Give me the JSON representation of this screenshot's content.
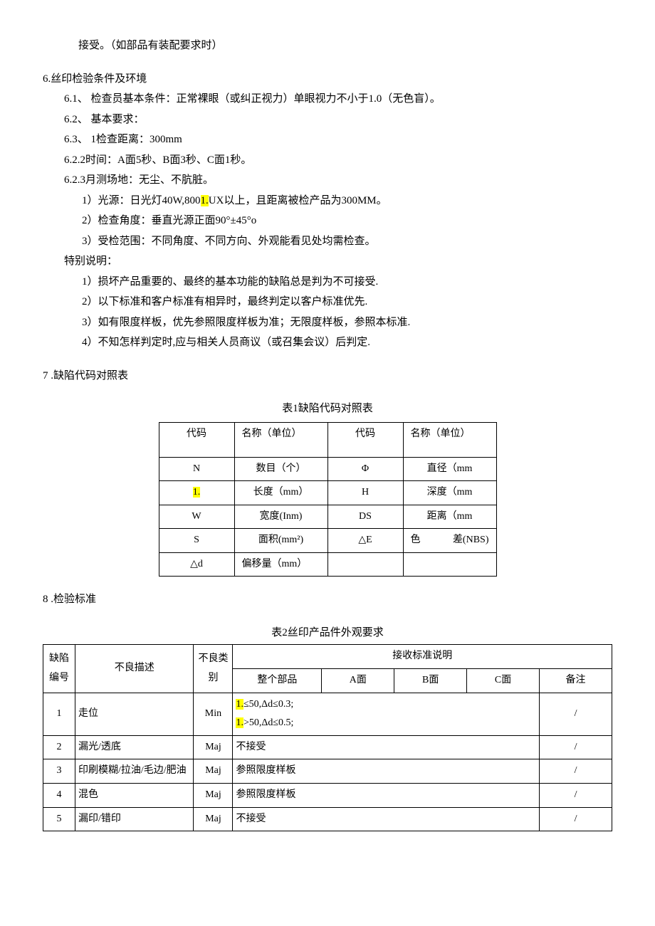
{
  "top_line": "接受。（如部品有装配要求时）",
  "s6": {
    "heading": "6.丝印检验条件及环境",
    "p1": "6.1、  检查员基本条件：正常裸眼（或纠正视力）单眼视力不小于1.0（无色盲）。",
    "p2": "6.2、  基本要求：",
    "p3": "6.3、 1检查距离：300mm",
    "p4": "6.2.2时间：A面5秒、B面3秒、C面1秒。",
    "p5": "6.2.3月测场地：无尘、不肮脏。",
    "p6_a": "1）光源：日光灯40W,800",
    "p6_hl": "1.",
    "p6_b": "UX以上，且距离被检产品为300MM。",
    "p7": "2）检查角度：垂直光源正面90°±45°o",
    "p8": "3）受检范围：不同角度、不同方向、外观能看见处均需检查。",
    "sp": "特别说明：",
    "sp1": "1）损坏产品重要的、最终的基本功能的缺陷总是判为不可接受.",
    "sp2": "2）以下标准和客户标准有相异时，最终判定以客户标准优先.",
    "sp3": "3）如有限度样板，优先参照限度样板为准；无限度样板，参照本标准.",
    "sp4": "4）不知怎样判定时,应与相关人员商议（或召集会议）后判定."
  },
  "s7": {
    "heading": "7   .缺陷代码对照表",
    "caption": "表1缺陷代码对照表",
    "head": [
      "代码",
      "名称（单位）",
      "代码",
      "名称（单位）"
    ],
    "rows": [
      {
        "a": "N",
        "b": "数目（个）",
        "c": "Φ",
        "d": "直径（mm"
      },
      {
        "a_hl": "1.",
        "b": "长度（mm）",
        "c": "H",
        "d": "深度（mm"
      },
      {
        "a": "W",
        "b": "宽度(Inm)",
        "c": "DS",
        "d": "距离（mm"
      },
      {
        "a": "S",
        "b": "面积(mm²)",
        "c": "△E",
        "d_a": "色",
        "d_b": "差(NBS)"
      },
      {
        "a": "△d",
        "b": "偏移量（mm）",
        "c": "",
        "d": ""
      }
    ]
  },
  "s8": {
    "heading": "8   .检验标准",
    "caption": "表2丝印产品件外观要求",
    "h_no": "缺陷编号",
    "h_desc": "不良描述",
    "h_type": "不良类别",
    "h_std": "接收标准说明",
    "h_part": "整个部品",
    "h_a": "A面",
    "h_b": "B面",
    "h_c": "C面",
    "h_remark": "备注",
    "rows": [
      {
        "no": "1",
        "desc": "走位",
        "type": "Min",
        "part_hl1": "1.",
        "part_1": "≤50,Δd≤0.3;",
        "part_hl2": "1.",
        "part_2": ">50,Δd≤0.5;",
        "remark": "/"
      },
      {
        "no": "2",
        "desc": "漏光/透底",
        "type": "Maj",
        "part": "不接受",
        "remark": "/"
      },
      {
        "no": "3",
        "desc": "印刷模糊/拉油/毛边/肥油",
        "type": "Maj",
        "part": "参照限度样板",
        "remark": "/"
      },
      {
        "no": "4",
        "desc": "混色",
        "type": "Maj",
        "part": "参照限度样板",
        "remark": "/"
      },
      {
        "no": "5",
        "desc": "漏印/错印",
        "type": "Maj",
        "part": "不接受",
        "remark": "/"
      }
    ]
  }
}
